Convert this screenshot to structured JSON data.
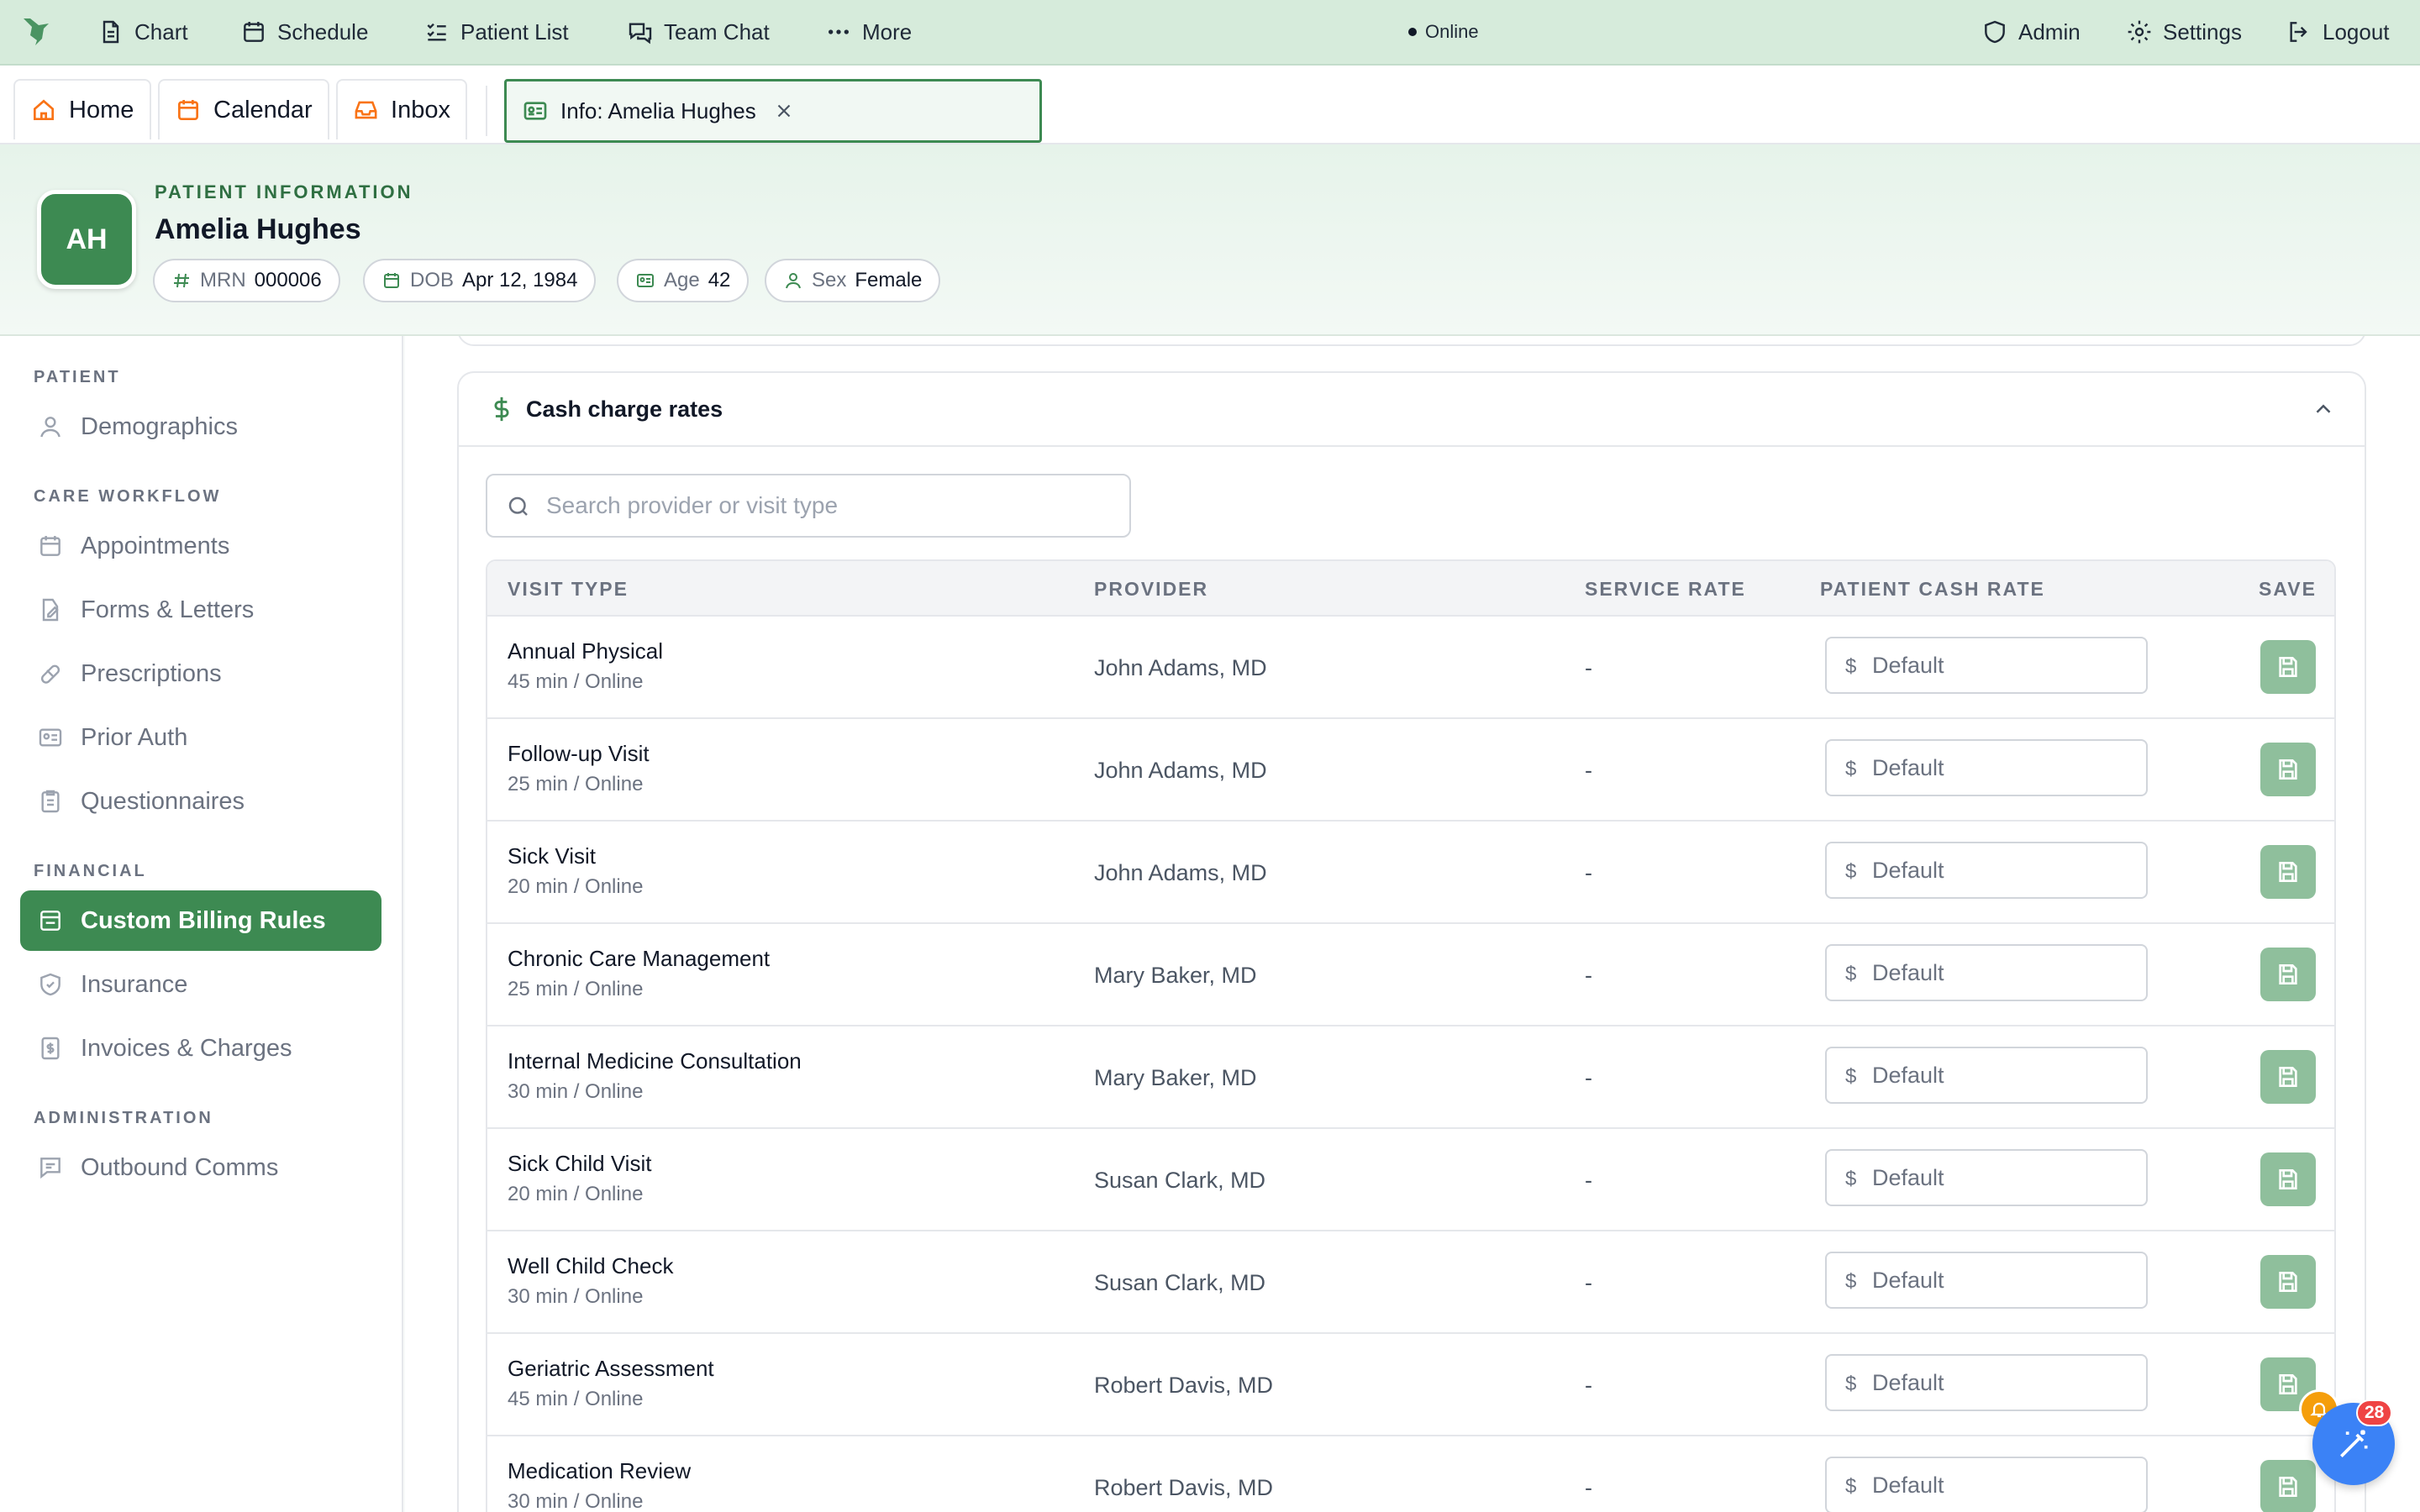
{
  "topnav": {
    "items": [
      {
        "label": "Chart",
        "icon": "document-icon"
      },
      {
        "label": "Schedule",
        "icon": "calendar-icon"
      },
      {
        "label": "Patient List",
        "icon": "list-icon"
      },
      {
        "label": "Team Chat",
        "icon": "chat-icon"
      },
      {
        "label": "More",
        "icon": "ellipsis-icon"
      }
    ],
    "status": "Online",
    "right": [
      {
        "label": "Admin",
        "icon": "shield-icon"
      },
      {
        "label": "Settings",
        "icon": "gear-icon"
      },
      {
        "label": "Logout",
        "icon": "logout-icon"
      }
    ],
    "accent": "#d6ebdb"
  },
  "tabs": {
    "home": "Home",
    "calendar": "Calendar",
    "inbox": "Inbox",
    "active": "Info: Amelia Hughes"
  },
  "patient": {
    "section_label": "PATIENT INFORMATION",
    "initials": "AH",
    "name": "Amelia Hughes",
    "mrn_label": "MRN",
    "mrn": "000006",
    "dob_label": "DOB",
    "dob": "Apr 12, 1984",
    "age_label": "Age",
    "age": "42",
    "sex_label": "Sex",
    "sex": "Female"
  },
  "sidebar": {
    "sections": {
      "patient": "PATIENT",
      "care": "CARE WORKFLOW",
      "financial": "FINANCIAL",
      "admin": "ADMINISTRATION"
    },
    "items": {
      "demographics": "Demographics",
      "appointments": "Appointments",
      "forms": "Forms & Letters",
      "prescriptions": "Prescriptions",
      "prior_auth": "Prior Auth",
      "questionnaires": "Questionnaires",
      "billing": "Custom Billing Rules",
      "insurance": "Insurance",
      "invoices": "Invoices & Charges",
      "outbound": "Outbound Comms"
    },
    "active_color": "#3d8a52"
  },
  "card": {
    "title": "Cash charge rates",
    "search_placeholder": "Search provider or visit type"
  },
  "table": {
    "headers": {
      "visit_type": "VISIT TYPE",
      "provider": "PROVIDER",
      "service_rate": "SERVICE RATE",
      "cash_rate": "PATIENT CASH RATE",
      "save": "SAVE"
    },
    "currency_symbol": "$",
    "input_placeholder": "Default",
    "rows": [
      {
        "visit": "Annual Physical",
        "sub": "45 min / Online",
        "provider": "John Adams, MD",
        "rate": "-"
      },
      {
        "visit": "Follow-up Visit",
        "sub": "25 min / Online",
        "provider": "John Adams, MD",
        "rate": "-"
      },
      {
        "visit": "Sick Visit",
        "sub": "20 min / Online",
        "provider": "John Adams, MD",
        "rate": "-"
      },
      {
        "visit": "Chronic Care Management",
        "sub": "25 min / Online",
        "provider": "Mary Baker, MD",
        "rate": "-"
      },
      {
        "visit": "Internal Medicine Consultation",
        "sub": "30 min / Online",
        "provider": "Mary Baker, MD",
        "rate": "-"
      },
      {
        "visit": "Sick Child Visit",
        "sub": "20 min / Online",
        "provider": "Susan Clark, MD",
        "rate": "-"
      },
      {
        "visit": "Well Child Check",
        "sub": "30 min / Online",
        "provider": "Susan Clark, MD",
        "rate": "-"
      },
      {
        "visit": "Geriatric Assessment",
        "sub": "45 min / Online",
        "provider": "Robert Davis, MD",
        "rate": "-"
      },
      {
        "visit": "Medication Review",
        "sub": "30 min / Online",
        "provider": "Robert Davis, MD",
        "rate": "-"
      }
    ]
  },
  "widgets": {
    "notification_count": "28"
  }
}
